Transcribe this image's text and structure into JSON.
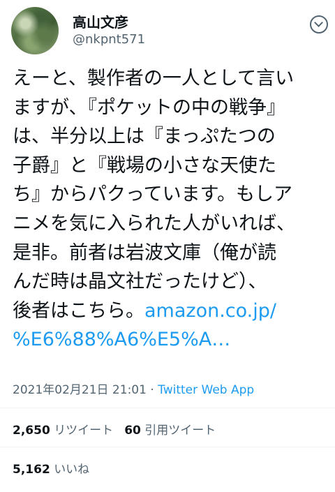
{
  "author": {
    "display_name": "高山文彦",
    "handle": "@nkpnt571"
  },
  "tweet": {
    "lines": [
      "えーと、製作者の一人として言い",
      "ますが、『ポケットの中の戦争』",
      "は、半分以上は『まっぷたつの",
      "子爵』と『戦場の小さな天使た",
      "ち』からパクっています。もしア",
      "ニメを気に入られた人がいれば、",
      "是非。前者は岩波文庫（俺が読",
      "んだ時は晶文社だったけど）、",
      "後者はこちら。"
    ],
    "link_part1": "amazon.co.jp/",
    "link_part2": "%E6%88%A6%E5%A…"
  },
  "meta": {
    "timestamp": "2021年02月21日 21:01",
    "separator": "·",
    "source": "Twitter Web App"
  },
  "stats": {
    "retweets_count": "2,650",
    "retweets_label": "リツイート",
    "quotes_count": "60",
    "quotes_label": "引用ツイート",
    "likes_count": "5,162",
    "likes_label": "いいね"
  }
}
